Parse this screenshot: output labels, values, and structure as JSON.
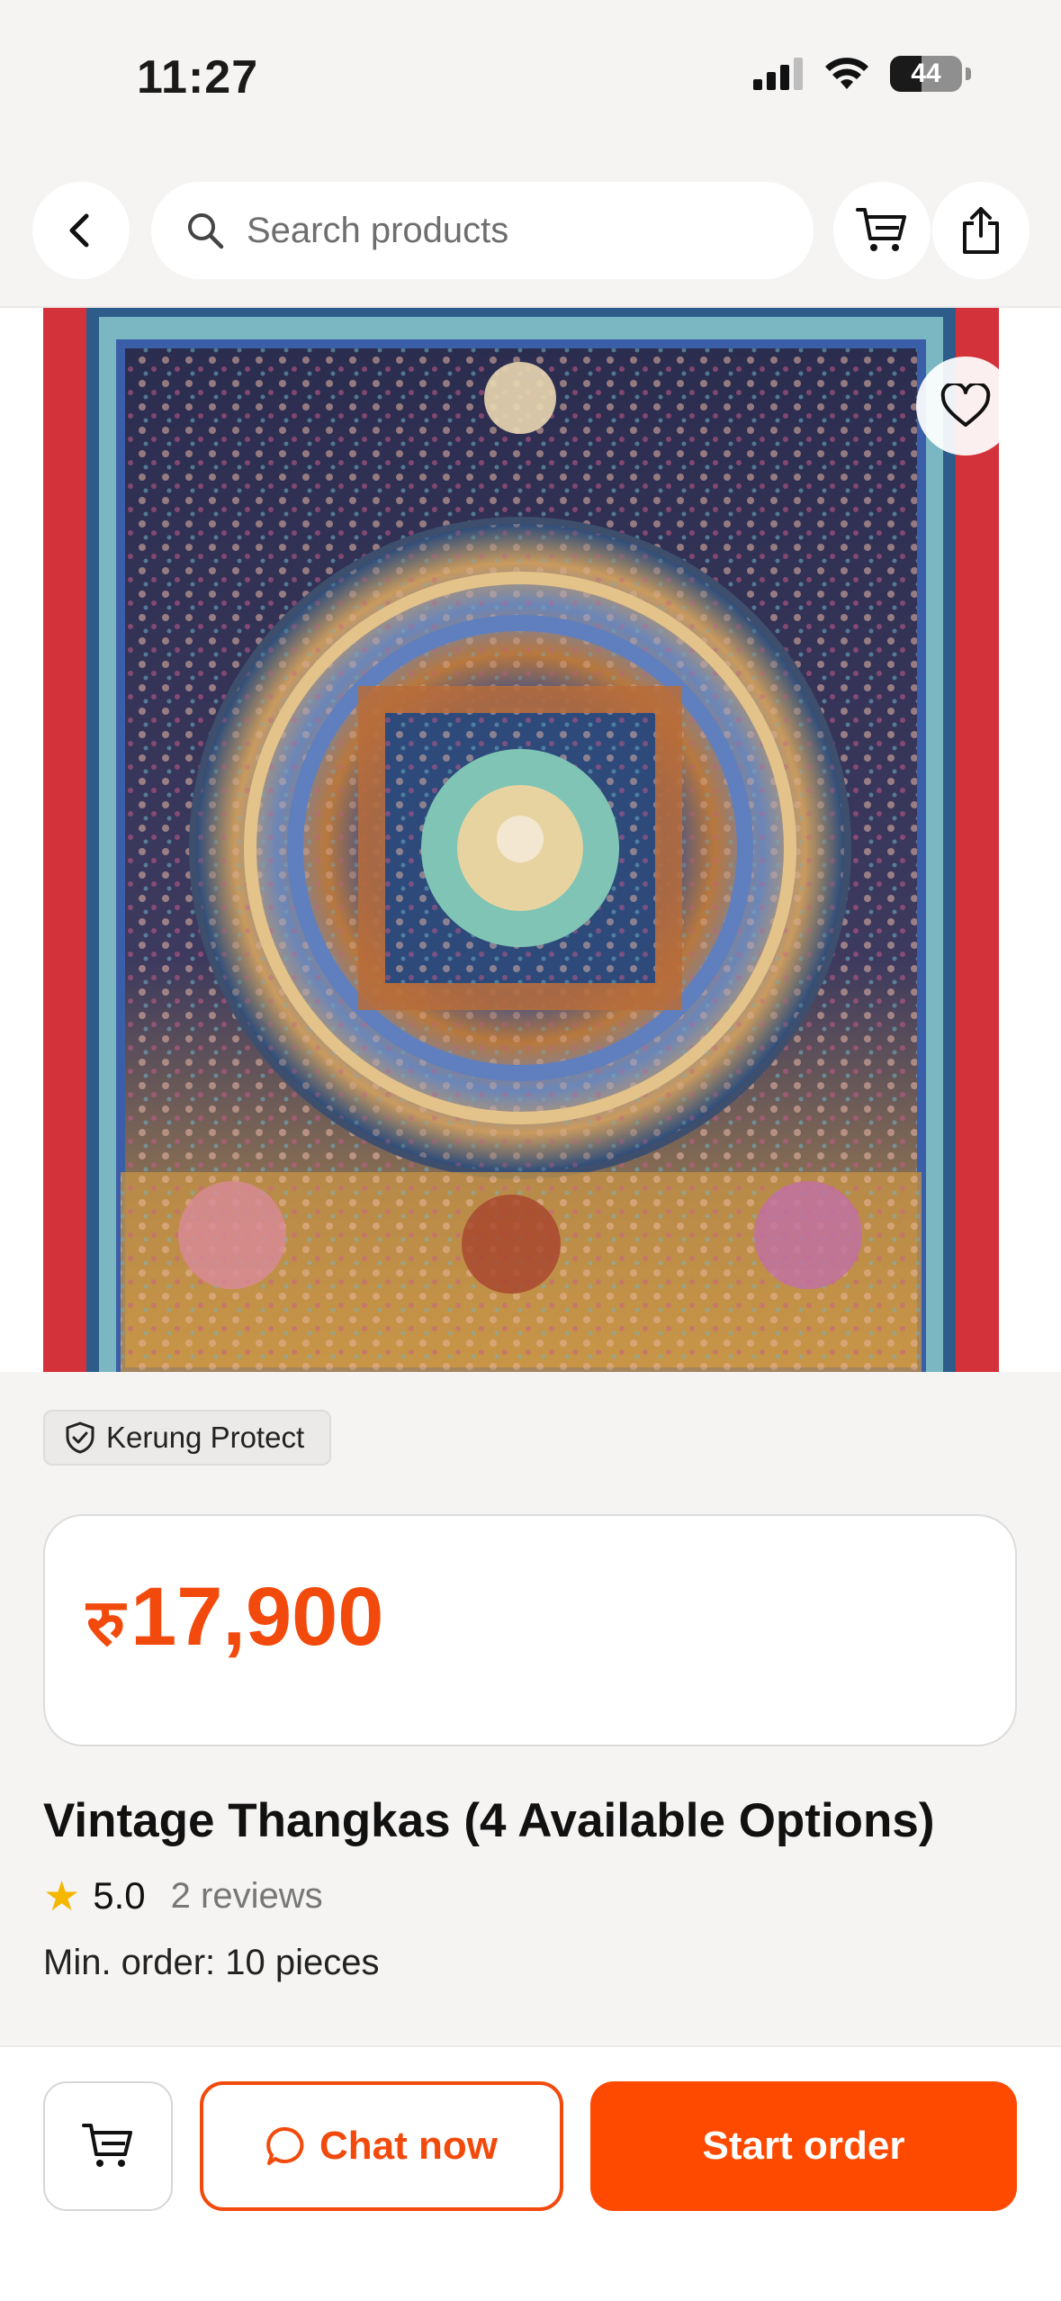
{
  "status_bar": {
    "time": "11:27",
    "battery": "44",
    "icons": [
      "signal-icon",
      "wifi-icon",
      "battery-icon"
    ]
  },
  "header": {
    "back_icon": "chevron-left-icon",
    "search_placeholder": "Search products",
    "cart_icon": "cart-icon",
    "share_icon": "share-icon"
  },
  "product": {
    "image_alt": "Thangka mandala painting",
    "favorite_icon": "heart-icon",
    "protect_badge": "Kerung Protect",
    "currency": "रु",
    "price": "17,900",
    "title": "Vintage Thangkas (4 Available Options)",
    "rating": "5.0",
    "reviews": "2 reviews",
    "min_order": "Min. order: 10 pieces"
  },
  "bottom_bar": {
    "chat_label": "Chat now",
    "start_order_label": "Start order"
  },
  "colors": {
    "accent": "#f24a0c",
    "start_button": "#fe4a00",
    "star": "#f5b700",
    "background": "#f5f4f3"
  }
}
